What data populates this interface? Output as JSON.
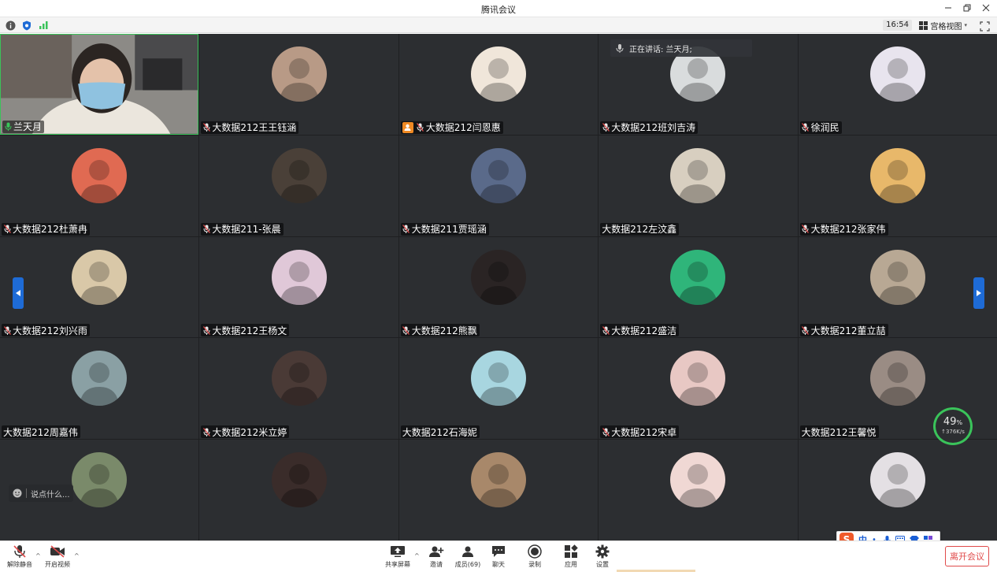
{
  "window": {
    "title": "腾讯会议"
  },
  "infobar": {
    "clock": "16:54",
    "view_label": "宫格视图"
  },
  "speaking": {
    "label": "正在讲话: 兰天月;"
  },
  "participants": [
    {
      "name": "兰天月",
      "type": "camera",
      "mic": "on"
    },
    {
      "name": "大数据212王王钰涵",
      "color": "#b89a86",
      "mic": "muted"
    },
    {
      "name": "大数据212闫恩惠",
      "color": "#f0e6da",
      "mic": "muted",
      "host": true
    },
    {
      "name": "大数据212班刘吉涛",
      "color": "#d9dcdd",
      "mic": "muted"
    },
    {
      "name": "徐润民",
      "color": "#e8e4ee",
      "mic": "muted"
    },
    {
      "name": "大数据212杜萧冉",
      "color": "#e06a52",
      "mic": "muted"
    },
    {
      "name": "大数据211-张晨",
      "color": "#4a4038",
      "mic": "muted"
    },
    {
      "name": "大数据211贾瑶涵",
      "color": "#5a6a8a",
      "mic": "muted"
    },
    {
      "name": "大数据212左汶鑫",
      "color": "#d8cfc0",
      "mic": "none"
    },
    {
      "name": "大数据212张家伟",
      "color": "#e8b86a",
      "mic": "muted"
    },
    {
      "name": "大数据212刘兴雨",
      "color": "#d9c8a8",
      "mic": "muted"
    },
    {
      "name": "大数据212王杨文",
      "color": "#e0c8d8",
      "mic": "muted"
    },
    {
      "name": "大数据212熊飘",
      "color": "#2a2424",
      "mic": "muted"
    },
    {
      "name": "大数据212盛洁",
      "color": "#2fb57a",
      "mic": "muted"
    },
    {
      "name": "大数据212董立喆",
      "color": "#b8a894",
      "mic": "muted"
    },
    {
      "name": "大数据212周嘉伟",
      "color": "#8aa0a4",
      "mic": "none"
    },
    {
      "name": "大数据212米立婷",
      "color": "#4a3a36",
      "mic": "muted"
    },
    {
      "name": "大数据212石海妮",
      "color": "#a8d6e0",
      "mic": "none"
    },
    {
      "name": "大数据212宋卓",
      "color": "#e8c8c4",
      "mic": "muted"
    },
    {
      "name": "大数据212王馨悦",
      "color": "#9a8c84",
      "mic": "none"
    },
    {
      "name": "",
      "color": "#7a8a6a",
      "mic": "none"
    },
    {
      "name": "",
      "color": "#3a2c2a",
      "mic": "none"
    },
    {
      "name": "",
      "color": "#a8886a",
      "mic": "none"
    },
    {
      "name": "",
      "color": "#f0d8d4",
      "mic": "none"
    },
    {
      "name": "",
      "color": "#e4e0e4",
      "mic": "none"
    }
  ],
  "chat_input": {
    "placeholder": "说点什么..."
  },
  "network": {
    "percent": "49",
    "percent_unit": "%",
    "speed": "↑376K/s"
  },
  "ime": {
    "mode": "中",
    "punct": "•,",
    "badge": "S"
  },
  "toolbar": {
    "unmute": "解除静音",
    "start_video": "开启视频",
    "share_screen": "共享屏幕",
    "invite": "邀请",
    "members": "成员(69)",
    "chat": "聊天",
    "record": "录制",
    "apps": "应用",
    "settings": "设置",
    "leave": "离开会议"
  },
  "colors": {
    "accent": "#1e6bd6",
    "speaking_green": "#3ac35a",
    "leave_red": "#e04a4a",
    "host_orange": "#f08a24"
  }
}
